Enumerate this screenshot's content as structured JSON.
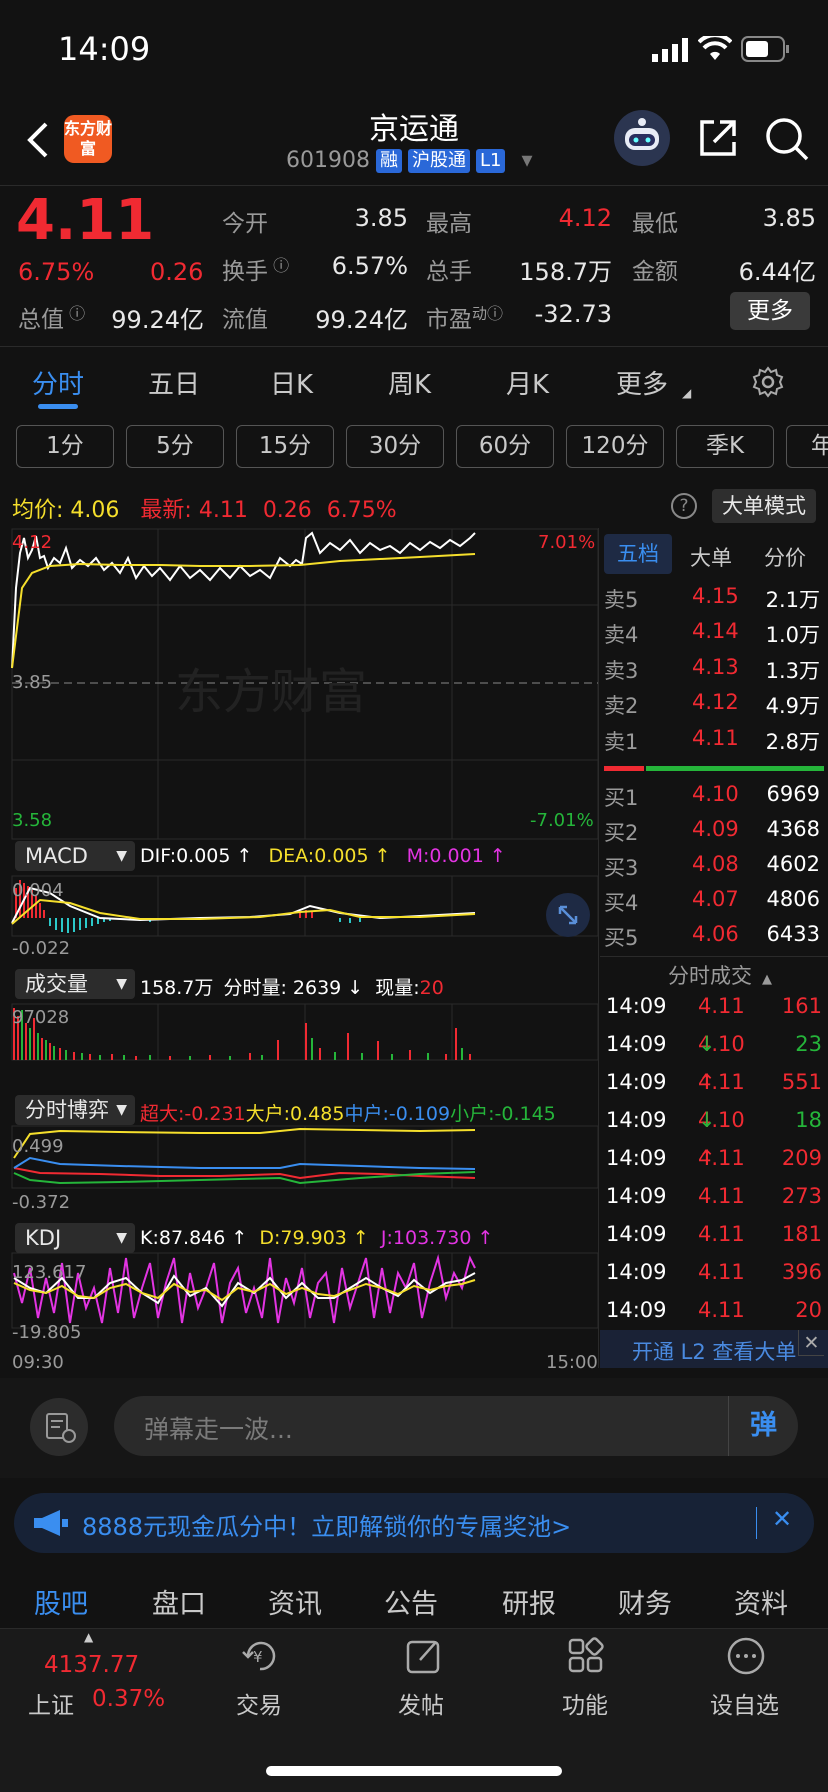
{
  "status_bar": {
    "time": "14:09"
  },
  "nav": {
    "title": "京运通",
    "code": "601908",
    "tags": [
      "融",
      "沪股通",
      "L1"
    ],
    "logo_text": "东方财富"
  },
  "quote": {
    "price": "4.11",
    "change_pct": "6.75%",
    "change": "0.26",
    "labels": {
      "open": "今开",
      "high": "最高",
      "low": "最低",
      "turnover": "换手",
      "volume": "总手",
      "amount": "金额",
      "total_cap": "总值",
      "float_cap": "流值",
      "pe": "市盈",
      "pe_sup": "动"
    },
    "values": {
      "open": "3.85",
      "high": "4.12",
      "low": "3.85",
      "turnover": "6.57%",
      "volume": "158.7万",
      "amount": "6.44亿",
      "total_cap": "99.24亿",
      "float_cap": "99.24亿",
      "pe": "-32.73"
    },
    "more_button": "更多"
  },
  "chart_tabs": [
    "分时",
    "五日",
    "日K",
    "周K",
    "月K",
    "更多"
  ],
  "period_buttons": [
    "1分",
    "5分",
    "15分",
    "30分",
    "60分",
    "120分",
    "季K",
    "年"
  ],
  "summary": {
    "avg_label": "均价:",
    "avg": "4.06",
    "latest_label": "最新:",
    "latest": "4.11",
    "change": "0.26",
    "pct": "6.75%",
    "big_order_mode": "大单模式"
  },
  "intraday_axis": {
    "top_left": "4.12",
    "top_right": "7.01%",
    "mid_left": "3.85",
    "bottom_left": "3.58",
    "bottom_right": "-7.01%",
    "time_start": "09:30",
    "time_end": "15:00",
    "watermark": "东方财富"
  },
  "orderbook": {
    "tabs": [
      "五档",
      "大单",
      "分价"
    ],
    "asks": [
      {
        "label": "卖5",
        "price": "4.15",
        "vol": "2.1万"
      },
      {
        "label": "卖4",
        "price": "4.14",
        "vol": "1.0万"
      },
      {
        "label": "卖3",
        "price": "4.13",
        "vol": "1.3万"
      },
      {
        "label": "卖2",
        "price": "4.12",
        "vol": "4.9万"
      },
      {
        "label": "卖1",
        "price": "4.11",
        "vol": "2.8万"
      }
    ],
    "bids": [
      {
        "label": "买1",
        "price": "4.10",
        "vol": "6969"
      },
      {
        "label": "买2",
        "price": "4.09",
        "vol": "4368"
      },
      {
        "label": "买3",
        "price": "4.08",
        "vol": "4602"
      },
      {
        "label": "买4",
        "price": "4.07",
        "vol": "4806"
      },
      {
        "label": "买5",
        "price": "4.06",
        "vol": "6433"
      }
    ]
  },
  "trades": {
    "title": "分时成交",
    "rows": [
      {
        "time": "14:09",
        "price": "4.11",
        "arrow": "",
        "vol": "161",
        "color": "red"
      },
      {
        "time": "14:09",
        "price": "4.10",
        "arrow": "↓",
        "vol": "23",
        "color": "green"
      },
      {
        "time": "14:09",
        "price": "4.11",
        "arrow": "↑",
        "vol": "551",
        "color": "red"
      },
      {
        "time": "14:09",
        "price": "4.10",
        "arrow": "↓",
        "vol": "18",
        "color": "green"
      },
      {
        "time": "14:09",
        "price": "4.11",
        "arrow": "↑",
        "vol": "209",
        "color": "red"
      },
      {
        "time": "14:09",
        "price": "4.11",
        "arrow": "",
        "vol": "273",
        "color": "red"
      },
      {
        "time": "14:09",
        "price": "4.11",
        "arrow": "",
        "vol": "181",
        "color": "red"
      },
      {
        "time": "14:09",
        "price": "4.11",
        "arrow": "",
        "vol": "396",
        "color": "red"
      },
      {
        "time": "14:09",
        "price": "4.11",
        "arrow": "",
        "vol": "20",
        "color": "red"
      }
    ],
    "l2_banner": "开通 L2 查看大单"
  },
  "indicators": {
    "macd": {
      "label": "MACD",
      "dif": "DIF:0.005 ↑",
      "dea": "DEA:0.005 ↑",
      "m": "M:0.001 ↑",
      "top": "0.004",
      "bottom": "-0.022"
    },
    "volume": {
      "label": "成交量",
      "total": "158.7万",
      "per_min": "分时量: 2639 ↓",
      "now_label": "现量:",
      "now": "20",
      "top": "97028"
    },
    "game": {
      "label": "分时博弈",
      "super": "超大:-0.231",
      "big": "大户:0.485",
      "mid": "中户:-0.109",
      "small": "小户:-0.145",
      "top": "0.499",
      "bottom": "-0.372"
    },
    "kdj": {
      "label": "KDJ",
      "k": "K:87.846 ↑",
      "d": "D:79.903 ↑",
      "j": "J:103.730 ↑",
      "top": "123.617",
      "bottom": "-19.805"
    }
  },
  "danmaku": {
    "placeholder": "弹幕走一波...",
    "send": "弹"
  },
  "promo": {
    "text": "8888元现金瓜分中！立即解锁你的专属奖池>"
  },
  "bottom_tabs": [
    "股吧",
    "盘口",
    "资讯",
    "公告",
    "研报",
    "财务",
    "资料"
  ],
  "dock": {
    "index_value": "4137.77",
    "index_name": "上证",
    "index_pct": "0.37%",
    "items": [
      "交易",
      "发帖",
      "功能",
      "设自选"
    ]
  },
  "colors": {
    "up": "#f02a32",
    "down": "#25b53a",
    "accent": "#3a8ef0",
    "background": "#121212"
  }
}
